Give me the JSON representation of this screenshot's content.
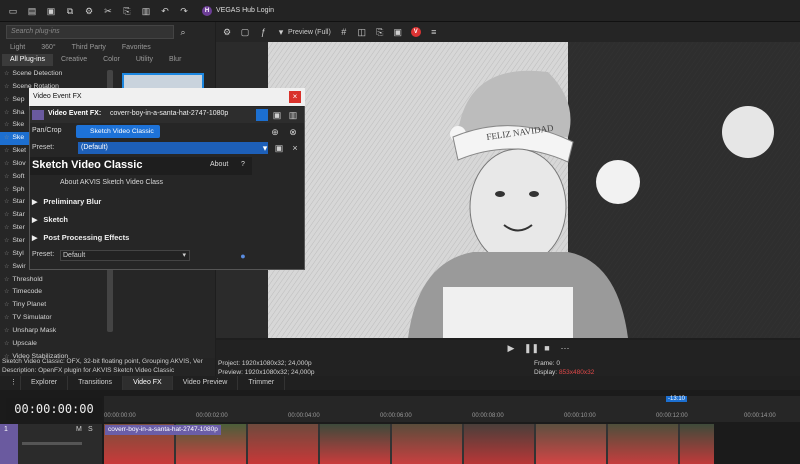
{
  "topbar": {
    "hub_label": "VEGAS Hub Login",
    "hub_badge": "H"
  },
  "leftpanel": {
    "search_placeholder": "Search plug-ins",
    "tabs_row1": [
      "Light",
      "360°",
      "Third Party",
      "Favorites"
    ],
    "tabs_row2": [
      "All Plug-ins",
      "Creative",
      "Color",
      "Utility",
      "Blur"
    ],
    "plugins": [
      "Scene Detection",
      "Scene Rotation",
      "Sep",
      "Sha",
      "Ske",
      "Ske",
      "Sket",
      "Slov",
      "Soft",
      "Sph",
      "Star",
      "Star",
      "Ster",
      "Ster",
      "Styl",
      "Swir",
      "Threshold",
      "Timecode",
      "Tiny Planet",
      "TV Simulator",
      "Unsharp Mask",
      "Upscale",
      "Video Stabilization"
    ],
    "selected_index": 5
  },
  "status": {
    "line1": "Sketch Video Classic: OFX, 32-bit floating point, Grouping AKVIS, Ver",
    "line2": "Description: OpenFX plugin for AKVIS Sketch Video Classic"
  },
  "preview": {
    "label": "Preview (Full)",
    "project_label": "Project:",
    "project_val": "1920x1080x32; 24,000p",
    "preview_label": "Preview:",
    "preview_val": "1920x1080x32; 24,000p",
    "frame_label": "Frame:",
    "frame_val": "0",
    "display_label": "Display:",
    "display_val": "853x480x32",
    "hat_text": "FELIZ NAVIDAD"
  },
  "bottom_tabs": [
    "Explorer",
    "Transitions",
    "Video FX",
    "Video Preview",
    "Trimmer"
  ],
  "timeline": {
    "timecode": "00:00:00:00",
    "ticks": [
      "00:00:00:00",
      "00:00:02:00",
      "00:00:04:00",
      "00:00:06:00",
      "00:00:08:00",
      "00:00:10:00",
      "00:00:12:00",
      "00:00:14:00"
    ],
    "clip_name": "coverr-boy-in-a-santa-hat-2747-1080p",
    "marker": "-13:10",
    "track_num": "1",
    "track_m": "M",
    "track_s": "S"
  },
  "dialog": {
    "title": "Video Event FX",
    "fx_label": "Video Event FX:",
    "fx_value": "coverr-boy-in-a-santa-hat-2747-1080p",
    "pan_crop": "Pan/Crop",
    "chain_plugin": "Sketch Video Classic",
    "preset_label": "Preset:",
    "preset_value": "(Default)",
    "plugin_title": "Sketch Video Classic",
    "about_btn": "About",
    "help_btn": "?",
    "about_text": "About AKVIS Sketch Video Class",
    "sections": [
      "Preliminary Blur",
      "Sketch",
      "Post Processing Effects"
    ],
    "preset2_label": "Preset:",
    "preset2_value": "Default"
  }
}
